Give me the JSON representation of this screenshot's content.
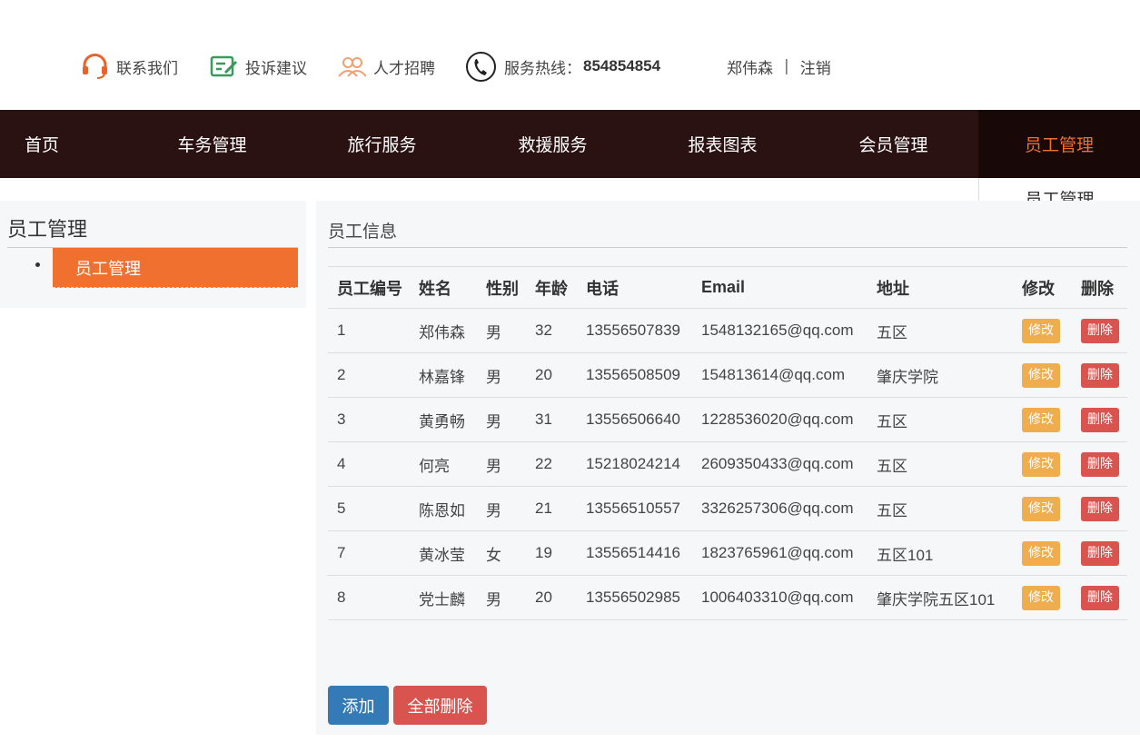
{
  "topbar": {
    "contact": "联系我们",
    "complaint": "投诉建议",
    "recruit": "人才招聘",
    "hotline_label": "服务热线：",
    "hotline_number": "854854854",
    "user": "郑伟森",
    "separator": "|",
    "logout": "注销"
  },
  "nav": {
    "items": [
      "首页",
      "车务管理",
      "旅行服务",
      "救援服务",
      "报表图表",
      "会员管理",
      "员工管理"
    ],
    "active_index": 6,
    "dropdown": "员工管理"
  },
  "sidebar": {
    "title": "员工管理",
    "item": "员工管理"
  },
  "panel": {
    "title": "员工信息",
    "columns": [
      "员工编号",
      "姓名",
      "性别",
      "年龄",
      "电话",
      "Email",
      "地址",
      "修改",
      "删除"
    ],
    "rows": [
      {
        "id": "1",
        "name": "郑伟森",
        "gender": "男",
        "age": "32",
        "phone": "13556507839",
        "email": "1548132165@qq.com",
        "address": "五区"
      },
      {
        "id": "2",
        "name": "林嘉锋",
        "gender": "男",
        "age": "20",
        "phone": "13556508509",
        "email": "154813614@qq.com",
        "address": "肇庆学院"
      },
      {
        "id": "3",
        "name": "黄勇畅",
        "gender": "男",
        "age": "31",
        "phone": "13556506640",
        "email": "1228536020@qq.com",
        "address": "五区"
      },
      {
        "id": "4",
        "name": "何亮",
        "gender": "男",
        "age": "22",
        "phone": "15218024214",
        "email": "2609350433@qq.com",
        "address": "五区"
      },
      {
        "id": "5",
        "name": "陈恩如",
        "gender": "男",
        "age": "21",
        "phone": "13556510557",
        "email": "3326257306@qq.com",
        "address": "五区"
      },
      {
        "id": "7",
        "name": "黄冰莹",
        "gender": "女",
        "age": "19",
        "phone": "13556514416",
        "email": "1823765961@qq.com",
        "address": "五区101"
      },
      {
        "id": "8",
        "name": "党士麟",
        "gender": "男",
        "age": "20",
        "phone": "13556502985",
        "email": "1006403310@qq.com",
        "address": "肇庆学院五区101"
      }
    ],
    "edit_label": "修改",
    "delete_label": "删除",
    "add_label": "添加",
    "delete_all_label": "全部删除"
  },
  "colors": {
    "nav_bg": "#2a1212",
    "accent": "#f07030",
    "primary": "#337ab7",
    "danger": "#d9534f",
    "warning": "#f0ad4e"
  },
  "icons": [
    "headset-icon",
    "edit-note-icon",
    "people-icon",
    "phone-icon"
  ]
}
